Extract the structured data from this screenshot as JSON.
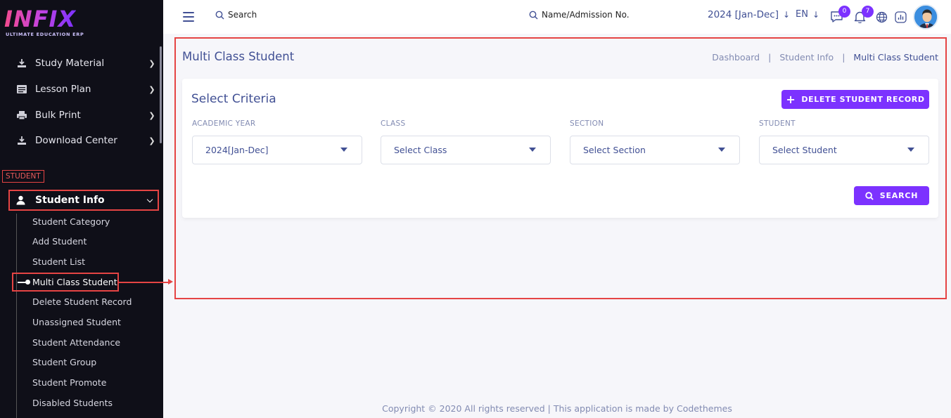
{
  "brand": {
    "logo_text": "INFIX",
    "tagline": "ULTIMATE EDUCATION ERP"
  },
  "sidebar": {
    "items": [
      {
        "label": "Study Material",
        "icon": "download-icon"
      },
      {
        "label": "Lesson Plan",
        "icon": "list-icon"
      },
      {
        "label": "Bulk Print",
        "icon": "printer-icon"
      },
      {
        "label": "Download Center",
        "icon": "download-icon"
      }
    ],
    "section_label": "STUDENT",
    "student_info": {
      "label": "Student Info",
      "icon": "user-icon"
    },
    "sub_items": [
      "Student Category",
      "Add Student",
      "Student List",
      "Multi Class Student",
      "Delete Student Record",
      "Unassigned Student",
      "Student Attendance",
      "Student Group",
      "Student Promote",
      "Disabled Students"
    ],
    "active_sub": "Multi Class Student"
  },
  "topbar": {
    "search_label": "Search",
    "name_search_label": "Name/Admission No.",
    "academic_year": "2024 [Jan-Dec]",
    "language": "EN",
    "messages_count": "0",
    "notifications_count": "7"
  },
  "page": {
    "title": "Multi Class Student",
    "breadcrumb": [
      "Dashboard",
      "Student Info",
      "Multi Class Student"
    ]
  },
  "criteria": {
    "title": "Select Criteria",
    "delete_button": "DELETE STUDENT RECORD",
    "fields": [
      {
        "label": "ACADEMIC YEAR",
        "value": "2024[Jan-Dec]"
      },
      {
        "label": "CLASS",
        "value": "Select Class"
      },
      {
        "label": "SECTION",
        "value": "Select Section"
      },
      {
        "label": "STUDENT",
        "value": "Select Student"
      }
    ],
    "search_button": "SEARCH"
  },
  "footer": {
    "text": "Copyright © 2020 All rights reserved | This application is made by Codethemes"
  },
  "colors": {
    "accent": "#7c32ff",
    "sidebar_bg": "#0f0f18",
    "highlight": "#e54444",
    "text": "#415094"
  }
}
